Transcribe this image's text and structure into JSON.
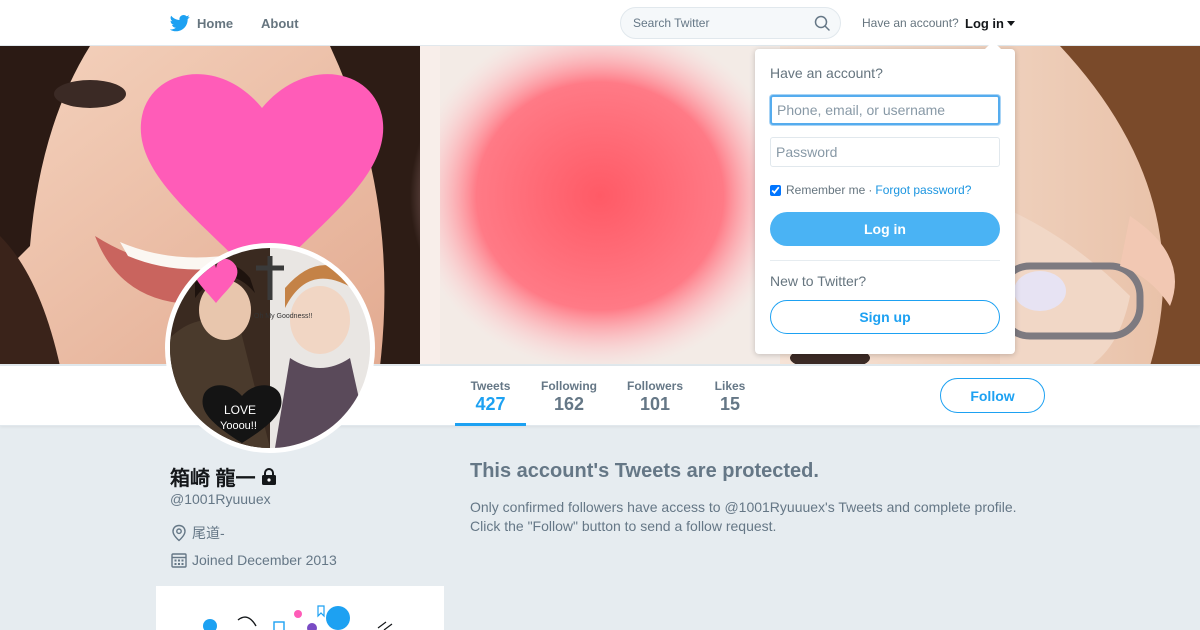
{
  "nav": {
    "home_label": "Home",
    "about_label": "About",
    "search_placeholder": "Search Twitter",
    "have_account_label": "Have an account?",
    "login_label": "Log in"
  },
  "login_dropdown": {
    "title": "Have an account?",
    "username_placeholder": "Phone, email, or username",
    "password_placeholder": "Password",
    "remember_label": "Remember me",
    "separator": "·",
    "forgot_label": "Forgot password?",
    "remember_checked": true,
    "login_button": "Log in",
    "new_label": "New to Twitter?",
    "signup_button": "Sign up"
  },
  "profile": {
    "name": "箱崎 龍一",
    "handle": "@1001Ryuuuex",
    "location": "尾道-",
    "joined": "Joined December 2013",
    "protected": true
  },
  "avatar": {
    "sticker_text": "Oh My Goodness!!",
    "love_line1": "LOVE",
    "love_line2": "Yooou!!"
  },
  "stats": [
    {
      "label": "Tweets",
      "value": "427",
      "active": true
    },
    {
      "label": "Following",
      "value": "162",
      "active": false
    },
    {
      "label": "Followers",
      "value": "101",
      "active": false
    },
    {
      "label": "Likes",
      "value": "15",
      "active": false
    }
  ],
  "follow_button": "Follow",
  "protected_message": {
    "title": "This account's Tweets are protected.",
    "line1": "Only confirmed followers have access to @1001Ryuuuex's Tweets and complete profile.",
    "line2": "Click the \"Follow\" button to send a follow request."
  },
  "colors": {
    "accent": "#1da1f2",
    "login_button": "#4ab3f4",
    "background": "#e6ecf0",
    "muted_text": "#657786",
    "heart_pink": "#ff5cb8"
  },
  "icons": [
    "twitter-bird-icon",
    "search-icon",
    "caret-down-icon",
    "lock-icon",
    "location-pin-icon",
    "calendar-icon"
  ]
}
